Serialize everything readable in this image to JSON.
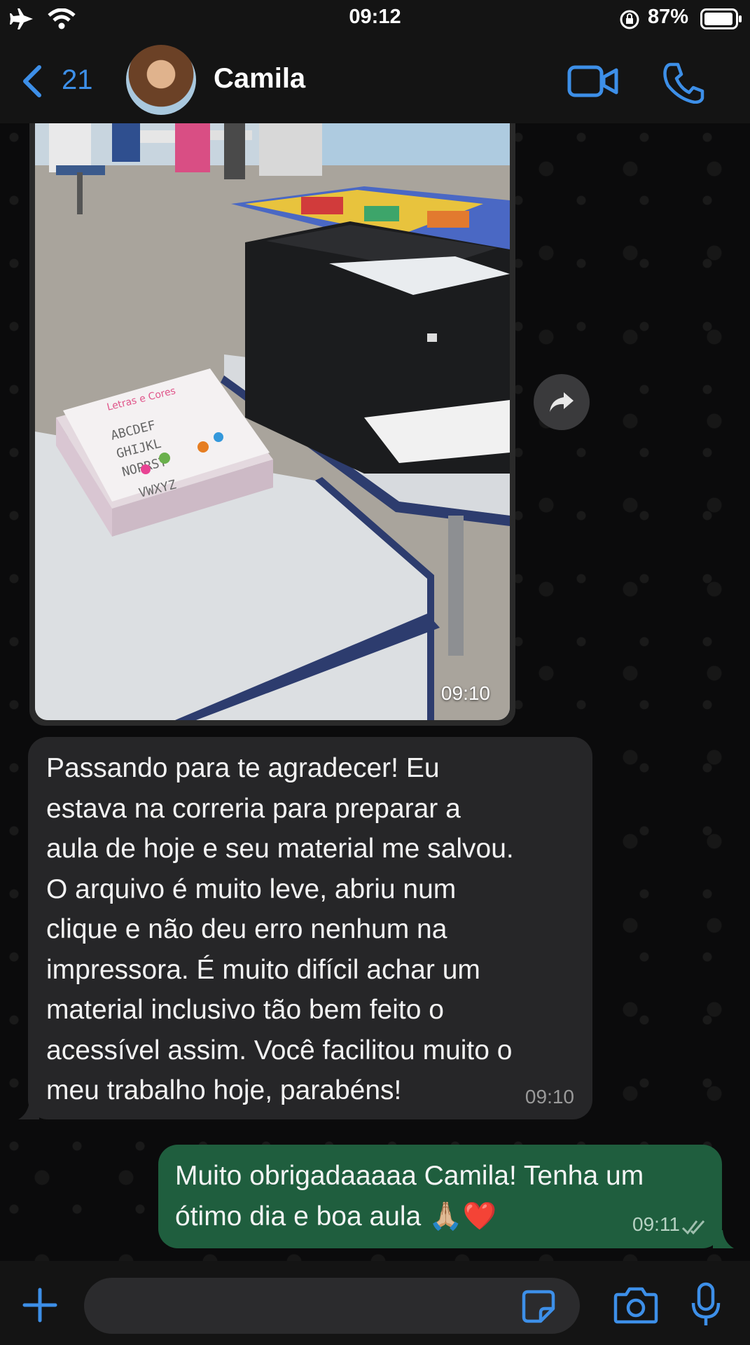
{
  "status": {
    "time": "09:12",
    "battery": "87%",
    "icons": [
      "airplane-icon",
      "wifi-icon",
      "orientation-lock-icon",
      "battery-icon"
    ]
  },
  "header": {
    "back_count": "21",
    "contact_name": "Camila",
    "icons": [
      "back-chevron-icon",
      "video-call-icon",
      "phone-icon"
    ],
    "accent_color": "#3d8fe8"
  },
  "messages": {
    "photo": {
      "time": "09:10"
    },
    "incoming": {
      "text": "Passando para te agradecer! Eu\nestava na correria para preparar a\naula de hoje e seu material me salvou.\nO arquivo é muito leve, abriu num\nclique e não deu erro nenhum na\nimpressora. É muito difícil achar um\nmaterial inclusivo tão bem feito o\nacessível assim. Você facilitou muito o\nmeu trabalho hoje, parabéns!",
      "time": "09:10"
    },
    "outgoing": {
      "text": "Muito obrigadaaaaa Camila! Tenha um\nótimo dia e boa aula 🙏🏼❤️",
      "time": "09:11"
    }
  },
  "photo_worksheet": {
    "title": "Letras e Cores",
    "rows": [
      "ABCDEF",
      "GHIJKL",
      "NOPRST",
      "VWXYZ"
    ]
  },
  "input_bar": {
    "icons": [
      "plus-icon",
      "sticker-icon",
      "camera-icon",
      "microphone-icon"
    ]
  },
  "colors": {
    "incoming_bubble": "#262628",
    "outgoing_bubble": "#1f5e3e",
    "background": "#0b0b0c"
  }
}
